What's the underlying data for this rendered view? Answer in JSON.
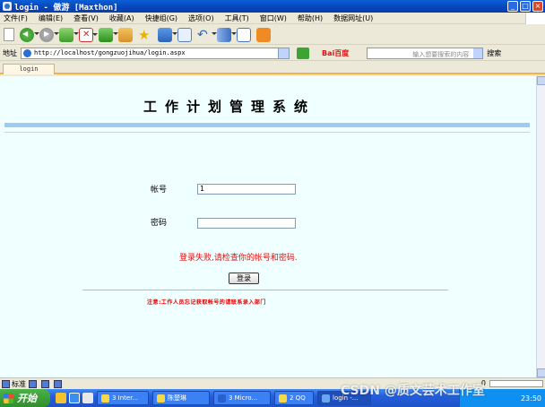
{
  "window": {
    "title": "login - 傲游 [Maxthon]",
    "controls": [
      "_",
      "□",
      "×"
    ]
  },
  "menu": [
    "文件(F)",
    "编辑(E)",
    "查看(V)",
    "收藏(A)",
    "快捷组(G)",
    "选项(O)",
    "工具(T)",
    "窗口(W)",
    "帮助(H)",
    "数据网址(U)"
  ],
  "address": {
    "label": "地址",
    "url": "http://localhost/gongzuojihua/login.aspx"
  },
  "search": {
    "engine": "Bai百度",
    "placeholder": "输入想要搜索的内容",
    "button": "搜索"
  },
  "tab": {
    "label": "login"
  },
  "page": {
    "title": "工作计划管理系统",
    "account_label": "帐号",
    "account_value": "1",
    "password_label": "密码",
    "password_value": "",
    "error": "登录失败,请检查你的帐号和密码.",
    "login_button": "登录",
    "note": "注意:工作人员忘记获取帐号的请联系录入部门"
  },
  "statusbar": {
    "mode": "标准",
    "right_text": "0",
    "speed": "",
    "progress": 0.0
  },
  "taskbar": {
    "start": "开始",
    "tasks": [
      "3 Inter...",
      "陈楚琳",
      "3 Micro...",
      "2 QQ",
      "login -..."
    ],
    "clock": "23:50"
  },
  "watermark": "CSDN @质文芸术工作室",
  "colors": {
    "page_bg": "#f0ffff",
    "rule": "#9ecbf0",
    "error": "#e01010",
    "titlebar": "#0a5fd8"
  }
}
